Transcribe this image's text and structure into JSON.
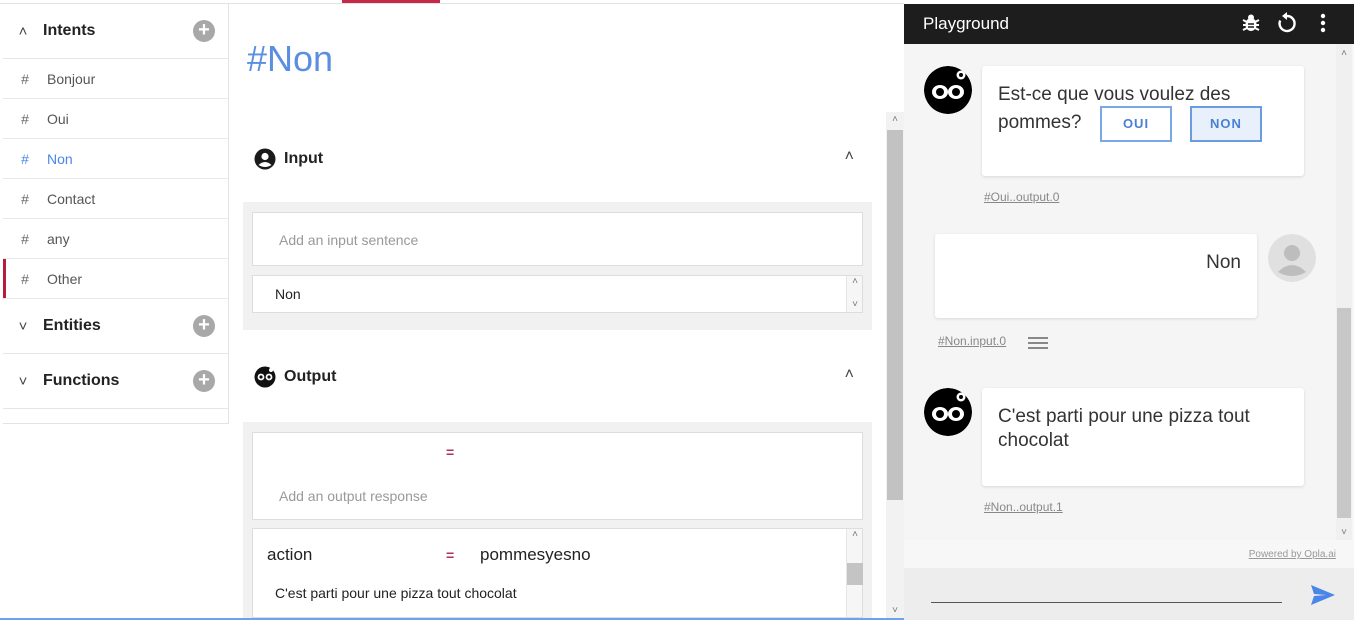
{
  "sidebar": {
    "intents": {
      "title": "Intents",
      "items": [
        {
          "label": "Bonjour"
        },
        {
          "label": "Oui"
        },
        {
          "label": "Non"
        },
        {
          "label": "Contact"
        },
        {
          "label": "any"
        },
        {
          "label": "Other"
        }
      ]
    },
    "entities": {
      "title": "Entities"
    },
    "functions": {
      "title": "Functions"
    }
  },
  "main": {
    "title": "#Non",
    "input": {
      "heading": "Input",
      "placeholder": "Add an input sentence",
      "sentence": "Non"
    },
    "output": {
      "heading": "Output",
      "equals_symbol": "=",
      "placeholder": "Add an output response",
      "action_key": "action",
      "action_value": "pommesyesno",
      "response": "C'est parti pour une pizza tout chocolat"
    }
  },
  "playground": {
    "title": "Playground",
    "messages": [
      {
        "from": "bot",
        "text_line1": "Est-ce que vous voulez des",
        "text_line2": "pommes?",
        "buttons": [
          "OUI",
          "NON"
        ],
        "ref": "#Oui..output.0"
      },
      {
        "from": "user",
        "text": "Non",
        "ref": "#Non.input.0"
      },
      {
        "from": "bot",
        "text_line1": "C'est parti pour une pizza tout",
        "text_line2": "chocolat",
        "ref": "#Non..output.1"
      }
    ],
    "powered_by": "Powered by Opla.ai"
  },
  "colors": {
    "accent_blue": "#5a8ee0",
    "active_red": "#b71c3a",
    "header_dark": "#1d1d1d"
  }
}
